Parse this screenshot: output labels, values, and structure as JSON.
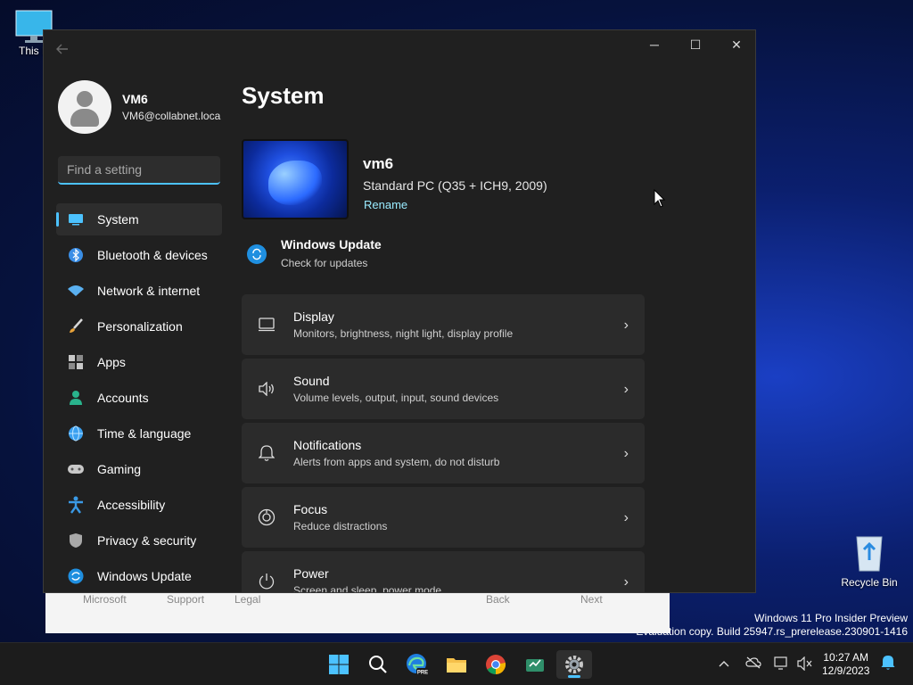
{
  "desktop": {
    "this_pc_label": "This P",
    "recycle_bin_label": "Recycle Bin",
    "watermark_line1": "Windows 11 Pro Insider Preview",
    "watermark_line2": "Evaluation copy. Build 25947.rs_prerelease.230901-1416"
  },
  "background_window": {
    "microsoft": "Microsoft",
    "support": "Support",
    "legal": "Legal",
    "back": "Back",
    "next": "Next"
  },
  "window": {
    "controls": {
      "minimize": "─",
      "maximize": "☐",
      "close": "✕"
    }
  },
  "profile": {
    "name": "VM6",
    "email": "VM6@collabnet.loca"
  },
  "search": {
    "placeholder": "Find a setting",
    "value": ""
  },
  "nav": {
    "items": [
      {
        "label": "System",
        "icon": "monitor-icon",
        "color": "#4cc2ff",
        "active": true
      },
      {
        "label": "Bluetooth & devices",
        "icon": "bluetooth-icon",
        "color": "#3a8ee6"
      },
      {
        "label": "Network & internet",
        "icon": "wifi-icon",
        "color": "#5ab0f0"
      },
      {
        "label": "Personalization",
        "icon": "brush-icon",
        "color": "#e8a33a"
      },
      {
        "label": "Apps",
        "icon": "apps-icon",
        "color": "#b0b0b0"
      },
      {
        "label": "Accounts",
        "icon": "person-icon",
        "color": "#29b38c"
      },
      {
        "label": "Time & language",
        "icon": "globe-clock-icon",
        "color": "#3aa0f0"
      },
      {
        "label": "Gaming",
        "icon": "gamepad-icon",
        "color": "#c8c8c8"
      },
      {
        "label": "Accessibility",
        "icon": "accessibility-icon",
        "color": "#3a9ae6"
      },
      {
        "label": "Privacy & security",
        "icon": "shield-icon",
        "color": "#a8a8a8"
      },
      {
        "label": "Windows Update",
        "icon": "update-icon",
        "color": "#1f8fe0"
      }
    ]
  },
  "main": {
    "title": "System",
    "device": {
      "name": "vm6",
      "model": "Standard PC (Q35 + ICH9, 2009)",
      "rename": "Rename"
    },
    "windows_update": {
      "title": "Windows Update",
      "subtitle": "Check for updates"
    },
    "cards": [
      {
        "title": "Display",
        "desc": "Monitors, brightness, night light, display profile",
        "icon": "display-icon"
      },
      {
        "title": "Sound",
        "desc": "Volume levels, output, input, sound devices",
        "icon": "speaker-icon"
      },
      {
        "title": "Notifications",
        "desc": "Alerts from apps and system, do not disturb",
        "icon": "bell-icon"
      },
      {
        "title": "Focus",
        "desc": "Reduce distractions",
        "icon": "focus-icon"
      },
      {
        "title": "Power",
        "desc": "Screen and sleep, power mode",
        "icon": "power-icon"
      }
    ]
  },
  "taskbar": {
    "apps": [
      "start-icon",
      "search-icon",
      "edge-pre-icon",
      "file-explorer-icon",
      "chrome-icon",
      "app-icon",
      "settings-icon"
    ],
    "pre_badge": "PRE",
    "clock_time": "10:27 AM",
    "clock_date": "12/9/2023"
  },
  "colors": {
    "accent": "#4cc2ff",
    "window_bg": "#202020",
    "card_bg": "#2b2b2b"
  }
}
